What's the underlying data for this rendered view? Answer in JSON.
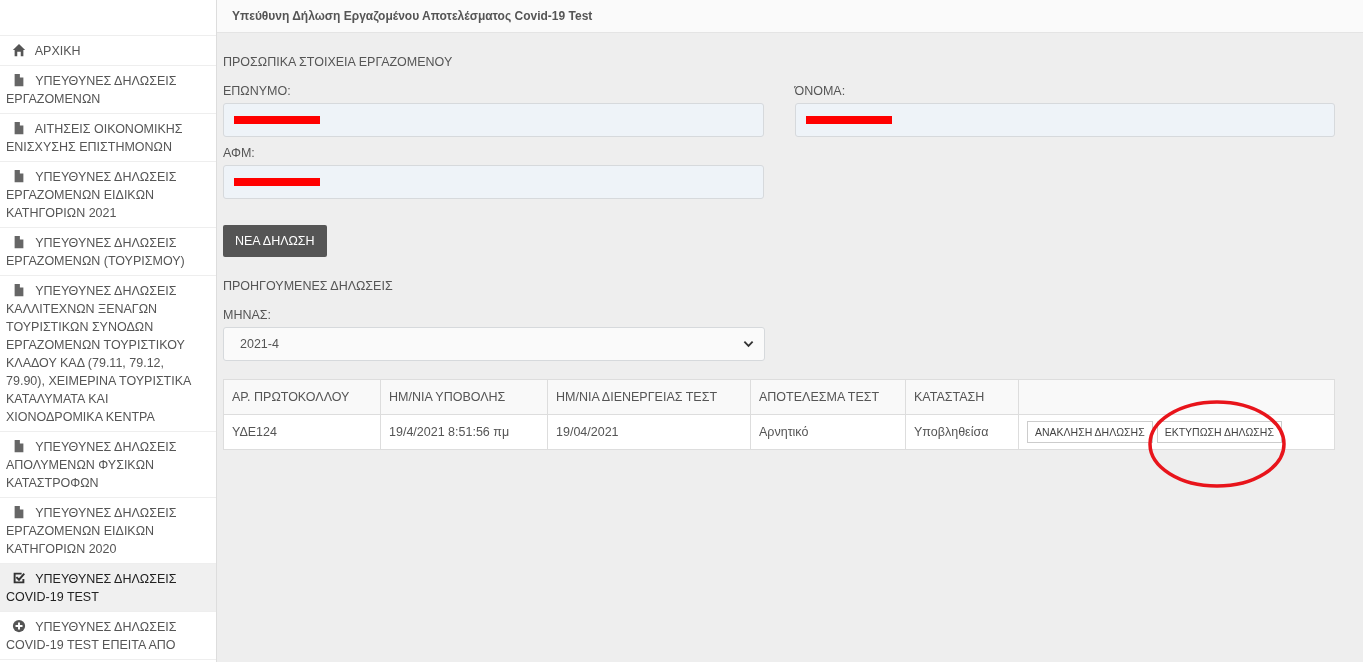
{
  "header": {
    "title": "Υπεύθυνη Δήλωση Εργαζομένου Αποτελέσματος Covid-19 Test"
  },
  "sidebar": {
    "items": [
      {
        "kind": "home",
        "label": "ΑΡΧΙΚΗ",
        "selected": false
      },
      {
        "kind": "file",
        "label": "ΥΠΕΥΘΥΝΕΣ ΔΗΛΩΣΕΙΣ ΕΡΓΑΖΟΜΕΝΩΝ",
        "selected": false
      },
      {
        "kind": "file",
        "label": "ΑΙΤΗΣΕΙΣ ΟΙΚΟΝΟΜΙΚΗΣ ΕΝΙΣΧΥΣΗΣ ΕΠΙΣΤΗΜΟΝΩΝ",
        "selected": false
      },
      {
        "kind": "file",
        "label": "ΥΠΕΥΘΥΝΕΣ ΔΗΛΩΣΕΙΣ ΕΡΓΑΖΟΜΕΝΩΝ ΕΙΔΙΚΩΝ ΚΑΤΗΓΟΡΙΩΝ 2021",
        "selected": false
      },
      {
        "kind": "file",
        "label": "ΥΠΕΥΘΥΝΕΣ ΔΗΛΩΣΕΙΣ ΕΡΓΑΖΟΜΕΝΩΝ (ΤΟΥΡΙΣΜΟΥ)",
        "selected": false
      },
      {
        "kind": "file",
        "label": "ΥΠΕΥΘΥΝΕΣ ΔΗΛΩΣΕΙΣ ΚΑΛΛΙΤΕΧΝΩΝ ΞΕΝΑΓΩΝ ΤΟΥΡΙΣΤΙΚΩΝ ΣΥΝΟΔΩΝ ΕΡΓΑΖΟΜΕΝΩΝ ΤΟΥΡΙΣΤΙΚΟΥ ΚΛΑΔΟΥ ΚΑΔ (79.11, 79.12, 79.90), ΧΕΙΜΕΡΙΝΑ ΤΟΥΡΙΣΤΙΚΑ ΚΑΤΑΛΥΜΑΤΑ ΚΑΙ ΧΙΟΝΟΔΡΟΜΙΚΑ ΚΕΝΤΡΑ",
        "selected": false
      },
      {
        "kind": "file",
        "label": "ΥΠΕΥΘΥΝΕΣ ΔΗΛΩΣΕΙΣ ΑΠΟΛΥΜΕΝΩΝ ΦΥΣΙΚΩΝ ΚΑΤΑΣΤΡΟΦΩΝ",
        "selected": false
      },
      {
        "kind": "file",
        "label": "ΥΠΕΥΘΥΝΕΣ ΔΗΛΩΣΕΙΣ ΕΡΓΑΖΟΜΕΝΩΝ ΕΙΔΙΚΩΝ ΚΑΤΗΓΟΡΙΩΝ 2020",
        "selected": false
      },
      {
        "kind": "check",
        "label": "ΥΠΕΥΘΥΝΕΣ ΔΗΛΩΣΕΙΣ COVID-19 TEST",
        "selected": true
      },
      {
        "kind": "plus",
        "label": "ΥΠΕΥΘΥΝΕΣ ΔΗΛΩΣΕΙΣ COVID-19 TEST ΕΠΕΙΤΑ ΑΠΟ",
        "selected": false
      }
    ]
  },
  "personal": {
    "heading": "ΠΡΟΣΩΠΙΚΑ ΣΤΟΙΧΕΙΑ ΕΡΓΑΖΟΜΕΝΟΥ",
    "fields": [
      {
        "label": "ΕΠΩΝΥΜΟ:",
        "redacted": true
      },
      {
        "label": "ΌΝΟΜΑ:",
        "redacted": true
      },
      {
        "label": "ΑΦΜ:",
        "redacted": true
      }
    ]
  },
  "new_button": "ΝΕΑ ΔΗΛΩΣΗ",
  "previous": {
    "heading": "ΠΡΟΗΓΟΥΜΕΝΕΣ ΔΗΛΩΣΕΙΣ",
    "month_label": "ΜΗΝΑΣ:",
    "month_value": "2021-4"
  },
  "table": {
    "columns": [
      "ΑΡ. ΠΡΩΤΟΚΟΛΛΟΥ",
      "ΗΜ/ΝΙΑ ΥΠΟΒΟΛΗΣ",
      "ΗΜ/ΝΙΑ ΔΙΕΝΕΡΓΕΙΑΣ ΤΕΣΤ",
      "ΑΠΟΤΕΛΕΣΜΑ ΤΕΣΤ",
      "ΚΑΤΑΣΤΑΣΗ"
    ],
    "rows": [
      {
        "cells": [
          "ΥΔΕ124",
          "19/4/2021 8:51:56 πμ",
          "19/04/2021",
          "Αρνητικό",
          "Υποβληθείσα"
        ],
        "actions": [
          {
            "label": "ΑΝΑΚΛΗΣΗ ΔΗΛΩΣΗΣ",
            "circled": false
          },
          {
            "label": "ΕΚΤΥΠΩΣΗ ΔΗΛΩΣΗΣ",
            "circled": true
          }
        ]
      }
    ]
  }
}
